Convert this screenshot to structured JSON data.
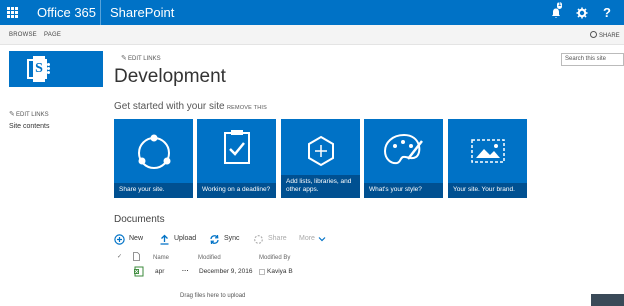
{
  "suite_bar": {
    "brand": "Office 365",
    "app_name": "SharePoint",
    "notification_count": "1",
    "help_glyph": "?",
    "icons": [
      "app-launcher-icon",
      "bell-icon",
      "gear-icon",
      "help-icon"
    ],
    "color": "#0072c6"
  },
  "ribbon": {
    "tabs": [
      "BROWSE",
      "PAGE"
    ],
    "share_label": "SHARE"
  },
  "search": {
    "placeholder": "Search this site"
  },
  "left_nav": {
    "edit_links": "EDIT LINKS",
    "items": [
      "Site contents"
    ]
  },
  "header": {
    "edit_links": "EDIT LINKS",
    "title": "Development"
  },
  "get_started": {
    "heading": "Get started with your site",
    "remove_label": "REMOVE THIS",
    "tiles": [
      {
        "caption": "Share your site.",
        "icon": "share-icon"
      },
      {
        "caption": "Working on a deadline?",
        "icon": "clipboard-check-icon"
      },
      {
        "caption": "Add lists, libraries, and other apps.",
        "icon": "add-apps-icon"
      },
      {
        "caption": "What's your style?",
        "icon": "palette-icon"
      },
      {
        "caption": "Your site. Your brand.",
        "icon": "picture-icon"
      }
    ]
  },
  "documents": {
    "title": "Documents",
    "commands": {
      "new": "New",
      "upload": "Upload",
      "sync": "Sync",
      "share": "Share",
      "more": "More"
    },
    "columns": {
      "name": "Name",
      "modified": "Modified",
      "modified_by": "Modified By"
    },
    "rows": [
      {
        "name": "apr",
        "modified": "December 9, 2016",
        "modified_by": "Kaviya B",
        "ellipsis": "..."
      }
    ],
    "drag_hint": "Drag files here to upload"
  }
}
